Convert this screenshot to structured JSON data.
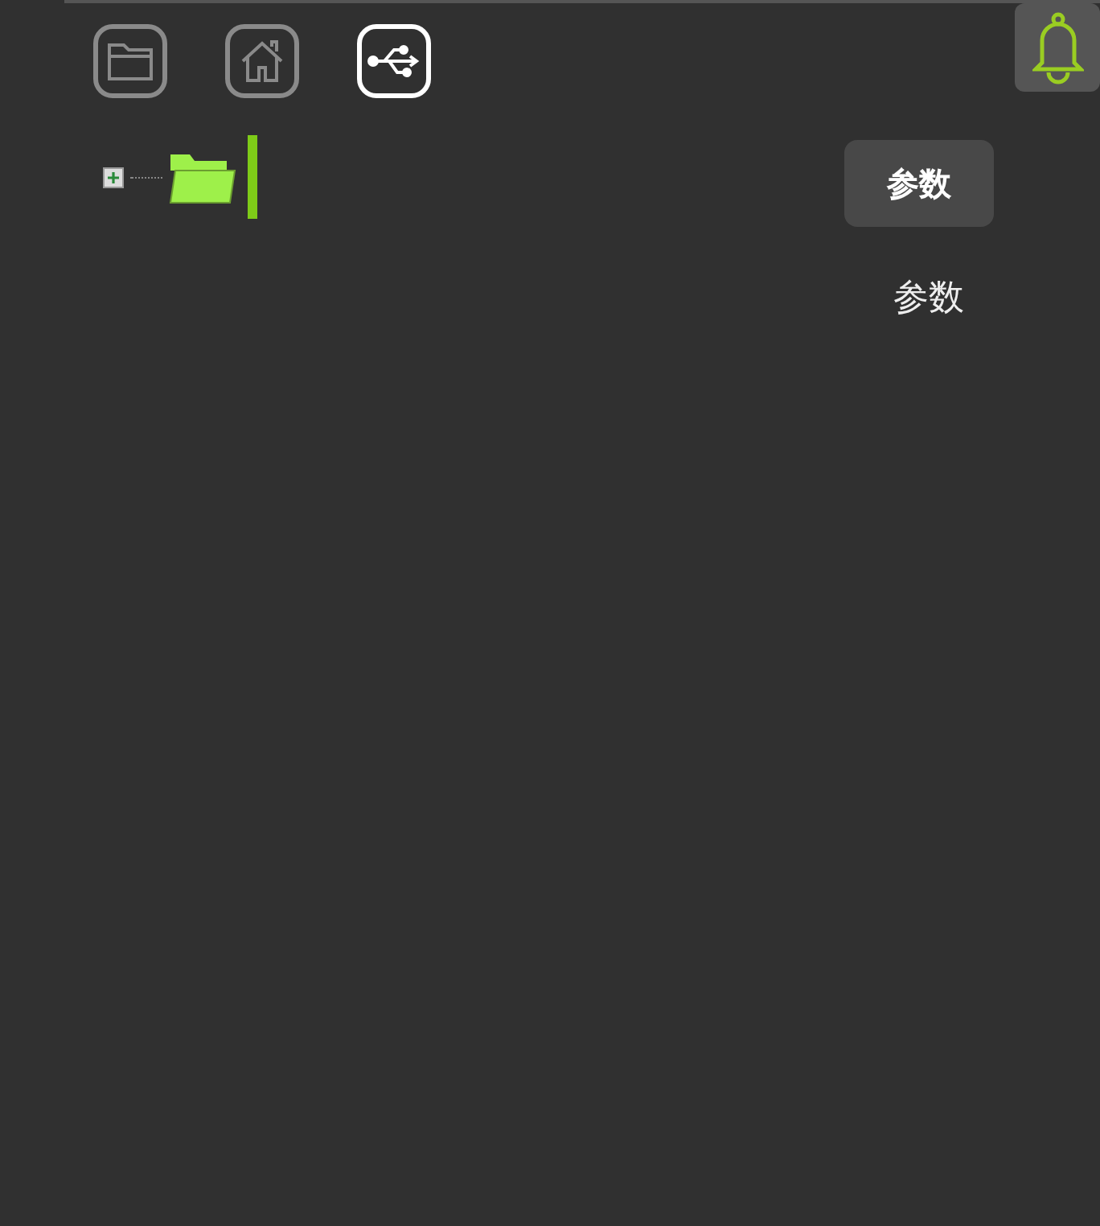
{
  "toolbar": {
    "buttons": [
      {
        "kind": "folder",
        "selected": false
      },
      {
        "kind": "home",
        "selected": false
      },
      {
        "kind": "usb",
        "selected": true
      }
    ]
  },
  "tree": {
    "nodes": [
      {
        "expanded": false,
        "selected": true
      }
    ]
  },
  "params_button": {
    "label": "参数"
  },
  "params_label": "参数"
}
